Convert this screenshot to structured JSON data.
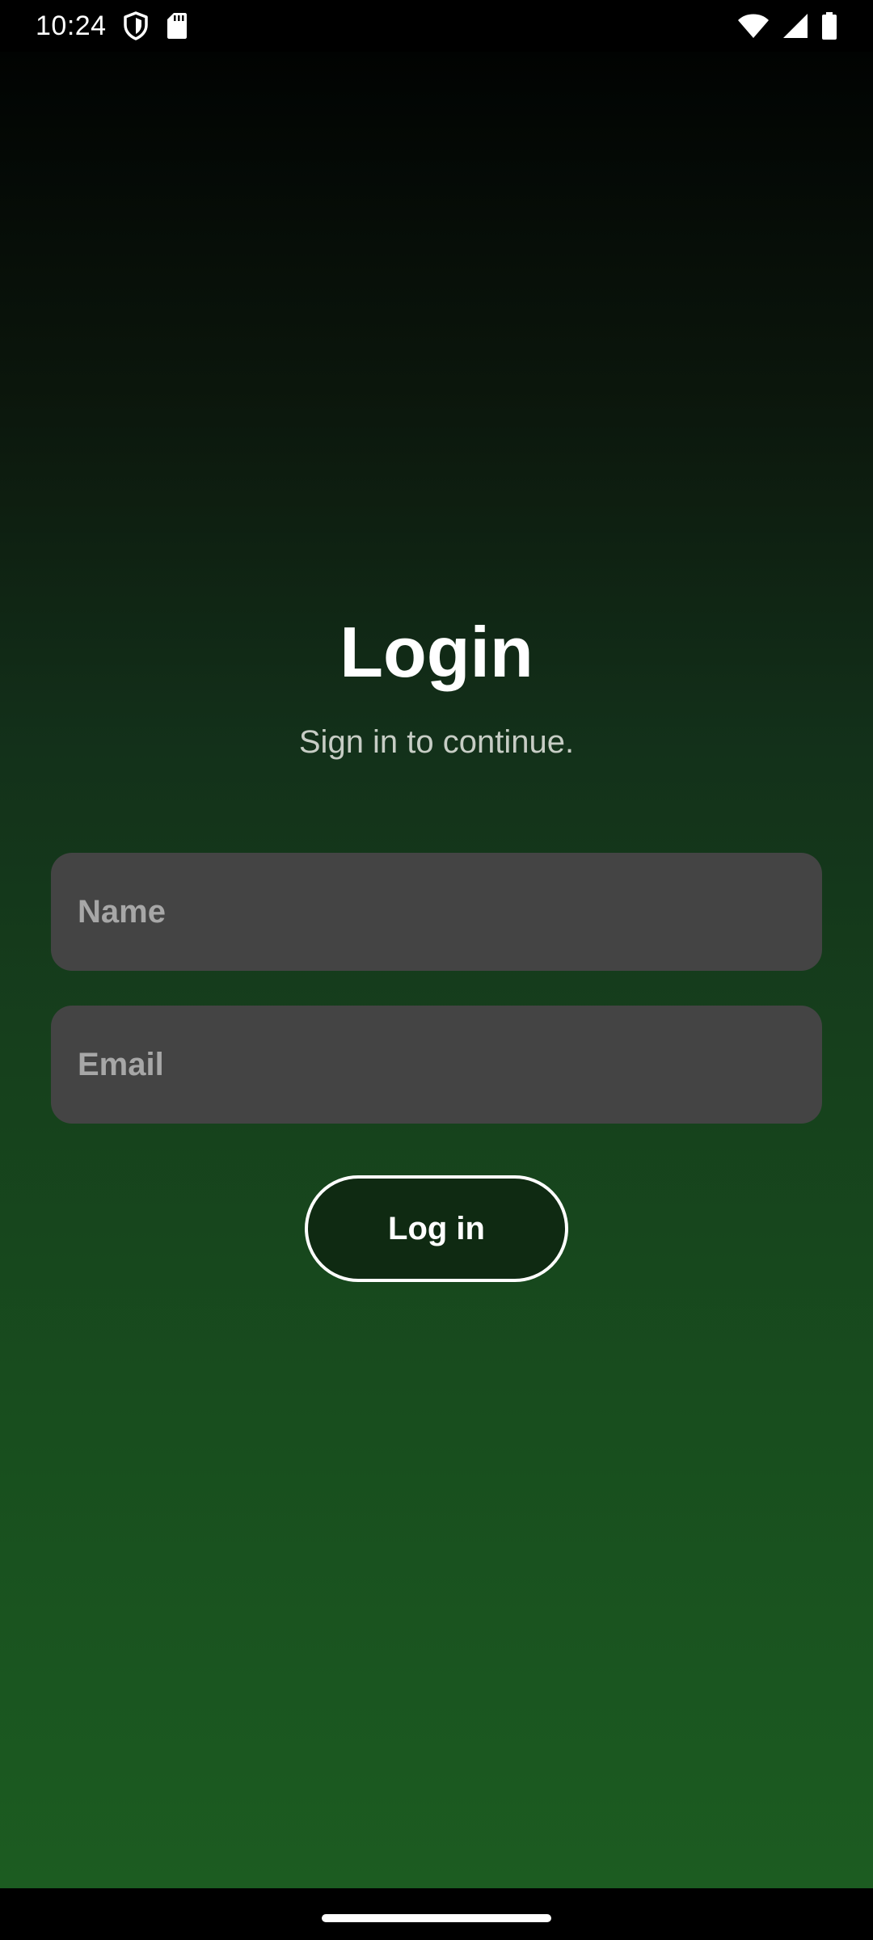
{
  "status_bar": {
    "time": "10:24",
    "left_icons": [
      "shield-icon",
      "sd-card-icon"
    ],
    "right_icons": [
      "wifi-icon",
      "cellular-signal-icon",
      "battery-icon"
    ]
  },
  "login": {
    "title": "Login",
    "subtitle": "Sign in to continue.",
    "name_placeholder": "Name",
    "email_placeholder": "Email",
    "login_button_label": "Log in"
  },
  "colors": {
    "background_gradient": [
      "#010302",
      "#1c5c21"
    ],
    "field_background": "#444444",
    "button_background": "#0f2a12",
    "button_border": "#ffffff"
  }
}
